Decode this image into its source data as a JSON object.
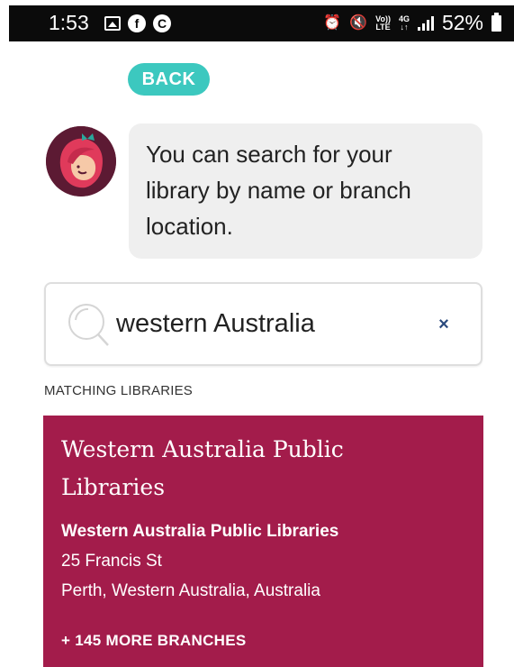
{
  "status_bar": {
    "time": "1:53",
    "icons_left": [
      "gallery-icon",
      "facebook-icon",
      "circle-c-icon"
    ],
    "icons_right": [
      "alarm-icon",
      "mute-icon",
      "volte-icon",
      "4g-icon",
      "signal-icon"
    ],
    "volte_top": "Vo))",
    "volte_bottom": "LTE",
    "network_top": "4G",
    "network_bottom": "↓↑",
    "battery_percent": "52%",
    "facebook_glyph": "f",
    "c_glyph": "C"
  },
  "back_button": {
    "label": "BACK",
    "color": "#3cc8bf"
  },
  "assistant": {
    "message_line1": "You can search for your",
    "message_line2": "library by name or branch",
    "message_line3": "location."
  },
  "search": {
    "value": "western Australia",
    "clear_label": "×"
  },
  "results": {
    "section_label": "MATCHING LIBRARIES",
    "card_color": "#a31c4b",
    "items": [
      {
        "title_line1": "Western Australia Public",
        "title_line2": "Libraries",
        "branch_name": "Western Australia Public Libraries",
        "address_line1": "25 Francis St",
        "address_line2": "Perth, Western Australia, Australia",
        "more_branches": "+ 145 MORE BRANCHES"
      }
    ]
  }
}
